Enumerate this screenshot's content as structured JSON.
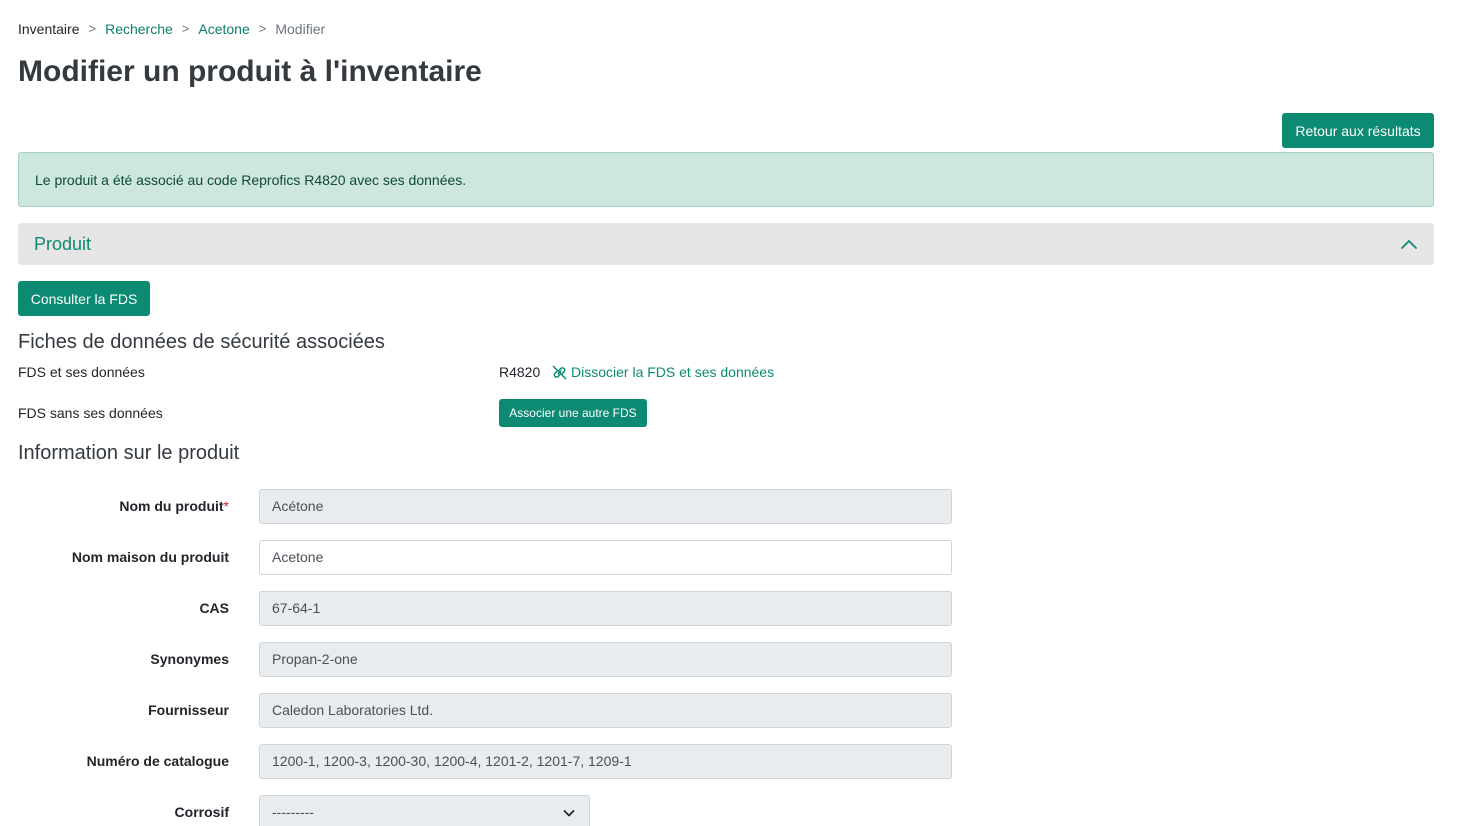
{
  "breadcrumb": {
    "root": "Inventaire",
    "items": [
      "Recherche",
      "Acetone"
    ],
    "current": "Modifier",
    "separator": ">"
  },
  "page_title": "Modifier un produit à l'inventaire",
  "back_button": "Retour aux résultats",
  "alert": "Le produit a été associé au code Reprofics R4820 avec ses données.",
  "section": {
    "title": "Produit",
    "expanded": true
  },
  "consult_sds_button": "Consulter la FDS",
  "sds_section": {
    "title": "Fiches de données de sécurité associées",
    "with_data_label": "FDS et ses données",
    "with_data_code": "R4820",
    "dissociate_link": "Dissocier la FDS et ses données",
    "without_data_label": "FDS sans ses données",
    "associate_button": "Associer une autre FDS"
  },
  "info_section": {
    "title": "Information sur le produit"
  },
  "form": {
    "product_name": {
      "label": "Nom du produit",
      "required_mark": "*",
      "value": "Acétone"
    },
    "house_name": {
      "label": "Nom maison du produit",
      "value": "Acetone"
    },
    "cas": {
      "label": "CAS",
      "value": "67-64-1"
    },
    "synonyms": {
      "label": "Synonymes",
      "value": "Propan-2-one"
    },
    "supplier": {
      "label": "Fournisseur",
      "value": "Caledon Laboratories Ltd."
    },
    "catalog": {
      "label": "Numéro de catalogue",
      "value": "1200-1, 1200-3, 1200-30, 1200-4, 1201-2, 1201-7, 1209-1"
    },
    "corrosive": {
      "label": "Corrosif",
      "value": "---------"
    }
  },
  "colors": {
    "accent": "#0c8a72",
    "alert_bg": "#cde6de",
    "section_bg": "#e6e6e6",
    "readonly_bg": "#e9ecef"
  }
}
